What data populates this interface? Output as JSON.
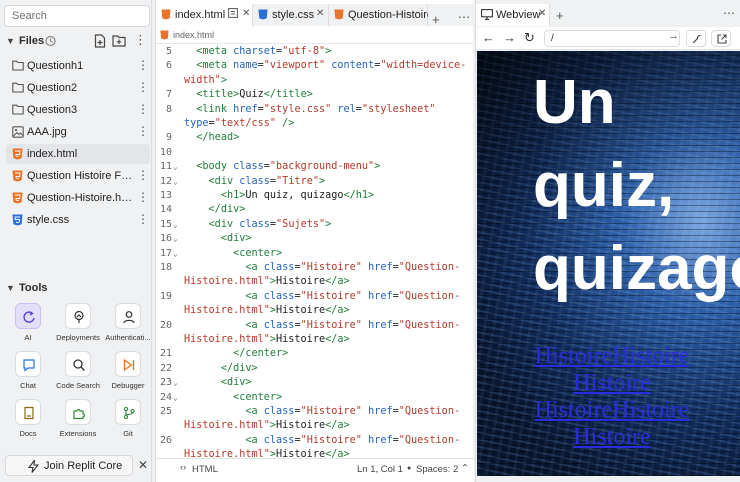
{
  "sidebar": {
    "search_placeholder": "Search",
    "files_title": "Files",
    "files": [
      {
        "name": "Questionh1",
        "type": "folder"
      },
      {
        "name": "Question2",
        "type": "folder"
      },
      {
        "name": "Question3",
        "type": "folder"
      },
      {
        "name": "AAA.jpg",
        "type": "image"
      },
      {
        "name": "index.html",
        "type": "html",
        "active": true
      },
      {
        "name": "Question Histoire Fini...",
        "type": "html"
      },
      {
        "name": "Question-Histoire.html",
        "type": "html"
      },
      {
        "name": "style.css",
        "type": "css"
      }
    ],
    "tools_title": "Tools",
    "tools": [
      {
        "label": "AI",
        "icon": "ai-icon"
      },
      {
        "label": "Deployments",
        "icon": "deployments-icon"
      },
      {
        "label": "Authenticati...",
        "icon": "user-icon"
      },
      {
        "label": "Chat",
        "icon": "chat-icon"
      },
      {
        "label": "Code Search",
        "icon": "search-icon"
      },
      {
        "label": "Debugger",
        "icon": "debugger-icon"
      },
      {
        "label": "Docs",
        "icon": "docs-icon"
      },
      {
        "label": "Extensions",
        "icon": "extensions-icon"
      },
      {
        "label": "Git",
        "icon": "git-icon"
      }
    ],
    "join_label": "Join Replit Core"
  },
  "editor": {
    "tabs": [
      {
        "label": "index.html",
        "active": true
      },
      {
        "label": "style.css"
      },
      {
        "label": "Question-Histoire.h"
      }
    ],
    "breadcrumb": "index.html",
    "lines": [
      {
        "n": "5",
        "fold": "",
        "html": "<span class='tag'>&lt;meta</span> <span class='att'>charset</span>=<span class='str'>\"utf-8\"</span><span class='tag'>&gt;</span>"
      },
      {
        "n": "6",
        "fold": "",
        "html": "<span class='tag'>&lt;meta</span> <span class='att'>name</span>=<span class='str'>\"viewport\"</span> <span class='att'>content</span>=<span class='str'>\"width=device-</span>"
      },
      {
        "n": "",
        "fold": "",
        "indent": true,
        "html": "<span class='str'>width\"</span><span class='tag'>&gt;</span>"
      },
      {
        "n": "7",
        "fold": "",
        "html": "<span class='tag'>&lt;title&gt;</span>Quiz<span class='tag'>&lt;/title&gt;</span>"
      },
      {
        "n": "8",
        "fold": "",
        "html": "<span class='tag'>&lt;link</span> <span class='att'>href</span>=<span class='str'>\"style.css\"</span> <span class='att'>rel</span>=<span class='str'>\"stylesheet\"</span>"
      },
      {
        "n": "",
        "fold": "",
        "indent": true,
        "html": "<span class='att'>type</span>=<span class='str'>\"text/css\"</span> <span class='tag'>/&gt;</span>"
      },
      {
        "n": "9",
        "fold": "",
        "html": "<span class='tag'>&lt;/head&gt;</span>"
      },
      {
        "n": "10",
        "fold": "",
        "html": ""
      },
      {
        "n": "11",
        "fold": "⌄",
        "html": "<span class='tag'>&lt;body</span> <span class='att'>class</span>=<span class='str'>\"background-menu\"</span><span class='tag'>&gt;</span>"
      },
      {
        "n": "12",
        "fold": "⌄",
        "html": "  <span class='tag'>&lt;div</span> <span class='att'>class</span>=<span class='str'>\"Titre\"</span><span class='tag'>&gt;</span>"
      },
      {
        "n": "13",
        "fold": "",
        "html": "    <span class='tag'>&lt;h1&gt;</span>Un quiz, quizago<span class='tag'>&lt;/h1&gt;</span>"
      },
      {
        "n": "14",
        "fold": "",
        "html": "  <span class='tag'>&lt;/div&gt;</span>"
      },
      {
        "n": "15",
        "fold": "⌄",
        "html": "  <span class='tag'>&lt;div</span> <span class='att'>class</span>=<span class='str'>\"Sujets\"</span><span class='tag'>&gt;</span>"
      },
      {
        "n": "16",
        "fold": "⌄",
        "html": "    <span class='tag'>&lt;div&gt;</span>"
      },
      {
        "n": "17",
        "fold": "⌄",
        "html": "      <span class='tag'>&lt;center&gt;</span>"
      },
      {
        "n": "18",
        "fold": "",
        "html": "        <span class='tag'>&lt;a</span> <span class='att'>class</span>=<span class='str'>\"Histoire\"</span> <span class='att'>href</span>=<span class='str'>\"Question-</span>"
      },
      {
        "n": "",
        "fold": "",
        "indent": true,
        "html": "<span class='str'>Histoire.html\"</span><span class='tag'>&gt;</span>Histoire<span class='tag'>&lt;/a&gt;</span>"
      },
      {
        "n": "19",
        "fold": "",
        "html": "        <span class='tag'>&lt;a</span> <span class='att'>class</span>=<span class='str'>\"Histoire\"</span> <span class='att'>href</span>=<span class='str'>\"Question-</span>"
      },
      {
        "n": "",
        "fold": "",
        "indent": true,
        "html": "<span class='str'>Histoire.html\"</span><span class='tag'>&gt;</span>Histoire<span class='tag'>&lt;/a&gt;</span>"
      },
      {
        "n": "20",
        "fold": "",
        "html": "        <span class='tag'>&lt;a</span> <span class='att'>class</span>=<span class='str'>\"Histoire\"</span> <span class='att'>href</span>=<span class='str'>\"Question-</span>"
      },
      {
        "n": "",
        "fold": "",
        "indent": true,
        "html": "<span class='str'>Histoire.html\"</span><span class='tag'>&gt;</span>Histoire<span class='tag'>&lt;/a&gt;</span>"
      },
      {
        "n": "21",
        "fold": "",
        "html": "      <span class='tag'>&lt;/center&gt;</span>"
      },
      {
        "n": "22",
        "fold": "",
        "html": "    <span class='tag'>&lt;/div&gt;</span>"
      },
      {
        "n": "23",
        "fold": "⌄",
        "html": "    <span class='tag'>&lt;div&gt;</span>"
      },
      {
        "n": "24",
        "fold": "⌄",
        "html": "      <span class='tag'>&lt;center&gt;</span>"
      },
      {
        "n": "25",
        "fold": "",
        "html": "        <span class='tag'>&lt;a</span> <span class='att'>class</span>=<span class='str'>\"Histoire\"</span> <span class='att'>href</span>=<span class='str'>\"Question-</span>"
      },
      {
        "n": "",
        "fold": "",
        "indent": true,
        "html": "<span class='str'>Histoire.html\"</span><span class='tag'>&gt;</span>Histoire<span class='tag'>&lt;/a&gt;</span>"
      },
      {
        "n": "26",
        "fold": "",
        "html": "        <span class='tag'>&lt;a</span> <span class='att'>class</span>=<span class='str'>\"Histoire\"</span> <span class='att'>href</span>=<span class='str'>\"Question-</span>"
      },
      {
        "n": "",
        "fold": "",
        "indent": true,
        "html": "<span class='str'>Histoire.html\"</span><span class='tag'>&gt;</span>Histoire<span class='tag'>&lt;/a&gt;</span>"
      }
    ],
    "status": {
      "lang": "HTML",
      "position": "Ln 1, Col 1",
      "spaces": "Spaces: 2"
    }
  },
  "webview": {
    "tab_label": "Webview",
    "url": "/",
    "heading_lines": [
      "Un",
      "quiz,",
      "quizago"
    ],
    "links": [
      "Histoire",
      "Histoire",
      "Histoire",
      "Histoire",
      "Histoire",
      "Histoire"
    ]
  }
}
